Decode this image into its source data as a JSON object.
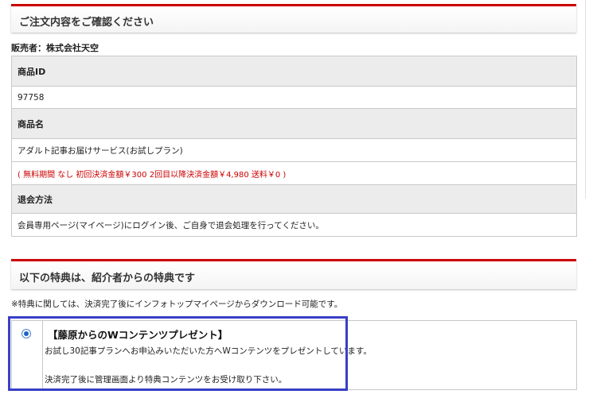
{
  "section1": {
    "title": "ご注文内容をご確認ください"
  },
  "seller": "販売者：株式会社天空",
  "order_table": {
    "product_id_label": "商品ID",
    "product_id": "97758",
    "product_name_label": "商品名",
    "product_name": "アダルト記事お届けサービス(お試しプラン)",
    "price_note": "( 無料期間 なし 初回決済金額￥300 2回目以降決済金額￥4,980 送料￥0 )",
    "cancel_label": "退会方法",
    "cancel_text": "会員専用ページ(マイページ)にログイン後、ご自身で退会処理を行ってください。"
  },
  "section2": {
    "title": "以下の特典は、紹介者からの特典です"
  },
  "bonus_note": "※特典に関しては、決済完了後にインフォトップマイページからダウンロード可能です。",
  "bonus": {
    "selected": true,
    "title": "【藤原からのWコンテンツプレゼント】",
    "line1": "お試し30記事プランへお申込みいただいた方へWコンテンツをプレゼントしています。",
    "line2": "決済完了後に管理画面より特典コンテンツをお受け取り下さい。"
  },
  "colors": {
    "accent_red": "#cc0000",
    "highlight": "#3a3fc6",
    "radio": "#1a63c6"
  }
}
